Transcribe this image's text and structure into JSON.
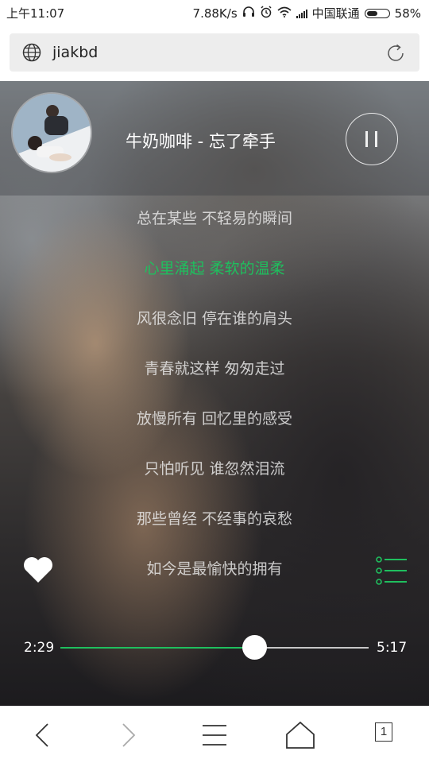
{
  "status_bar": {
    "time": "上午11:07",
    "network_speed": "7.88K/s",
    "carrier": "中国联通",
    "battery": "58%",
    "battery_level": 0.58
  },
  "browser": {
    "url": "jiakbd"
  },
  "player": {
    "song_title": "牛奶咖啡 - 忘了牵手",
    "lyrics": [
      "总在某些 不轻易的瞬间",
      "心里涌起 柔软的温柔",
      "风很念旧 停在谁的肩头",
      "青春就这样 匆匆走过",
      "放慢所有 回忆里的感受",
      "只怕听见 谁忽然泪流",
      "那些曾经 不经事的哀愁",
      "如今是最愉快的拥有"
    ],
    "active_lyric_index": 1,
    "current_time": "2:29",
    "total_time": "5:17",
    "progress": 0.63,
    "accent_color": "#1fbf5e"
  },
  "bottom_nav": {
    "tab_count": "1"
  }
}
